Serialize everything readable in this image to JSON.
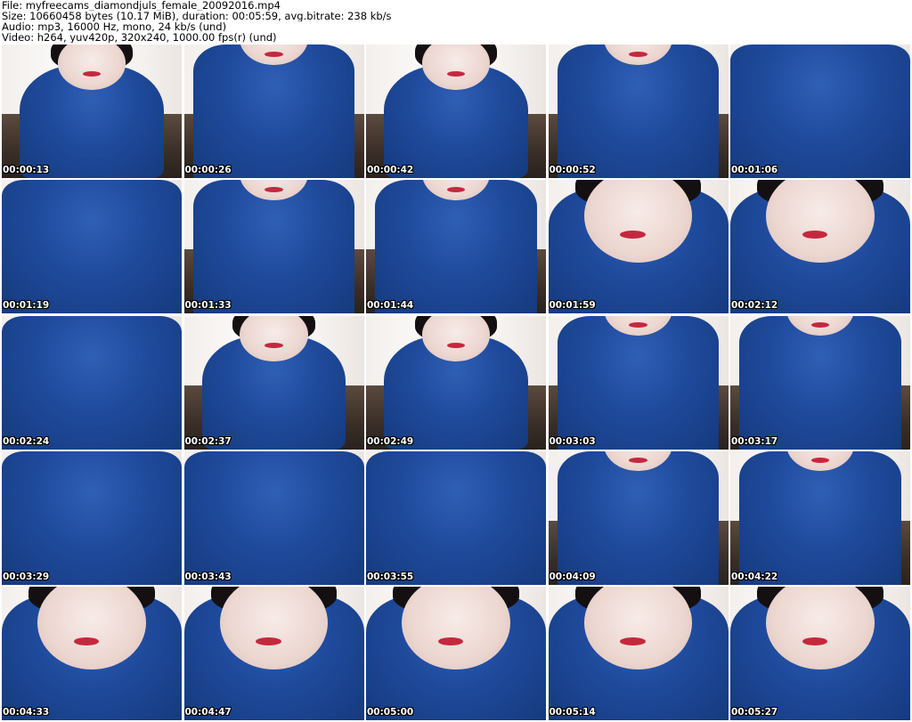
{
  "header": {
    "file_line": "File: myfreecams_diamondjuls_female_20092016.mp4",
    "size_line": "Size: 10660458 bytes (10.17 MiB), duration: 00:05:59, avg.bitrate: 238 kb/s",
    "audio_line": "Audio: mp3, 16000 Hz, mono, 24 kb/s (und)",
    "video_line": "Video: h264, yuv420p, 320x240, 1000.00 fps(r) (und)"
  },
  "thumbnails": [
    {
      "timestamp": "00:00:13",
      "variant": "v-face"
    },
    {
      "timestamp": "00:00:26",
      "variant": "v-lean"
    },
    {
      "timestamp": "00:00:42",
      "variant": "v-face"
    },
    {
      "timestamp": "00:00:52",
      "variant": "v-lean"
    },
    {
      "timestamp": "00:01:06",
      "variant": "v-torso"
    },
    {
      "timestamp": "00:01:19",
      "variant": "v-torso"
    },
    {
      "timestamp": "00:01:33",
      "variant": "v-lean"
    },
    {
      "timestamp": "00:01:44",
      "variant": "v-lean"
    },
    {
      "timestamp": "00:01:59",
      "variant": "v-close"
    },
    {
      "timestamp": "00:02:12",
      "variant": "v-close"
    },
    {
      "timestamp": "00:02:24",
      "variant": "v-torso"
    },
    {
      "timestamp": "00:02:37",
      "variant": "v-face"
    },
    {
      "timestamp": "00:02:49",
      "variant": "v-face"
    },
    {
      "timestamp": "00:03:03",
      "variant": "v-lean"
    },
    {
      "timestamp": "00:03:17",
      "variant": "v-lean"
    },
    {
      "timestamp": "00:03:29",
      "variant": "v-torso"
    },
    {
      "timestamp": "00:03:43",
      "variant": "v-torso"
    },
    {
      "timestamp": "00:03:55",
      "variant": "v-torso"
    },
    {
      "timestamp": "00:04:09",
      "variant": "v-lean"
    },
    {
      "timestamp": "00:04:22",
      "variant": "v-lean"
    },
    {
      "timestamp": "00:04:33",
      "variant": "v-close"
    },
    {
      "timestamp": "00:04:47",
      "variant": "v-close"
    },
    {
      "timestamp": "00:05:00",
      "variant": "v-close"
    },
    {
      "timestamp": "00:05:14",
      "variant": "v-close"
    },
    {
      "timestamp": "00:05:27",
      "variant": "v-close"
    }
  ],
  "colors": {
    "background": "#ffffff",
    "header_text": "#000000",
    "timestamp_text": "#ffffff",
    "sweater_blue": "#1f4a9c"
  }
}
